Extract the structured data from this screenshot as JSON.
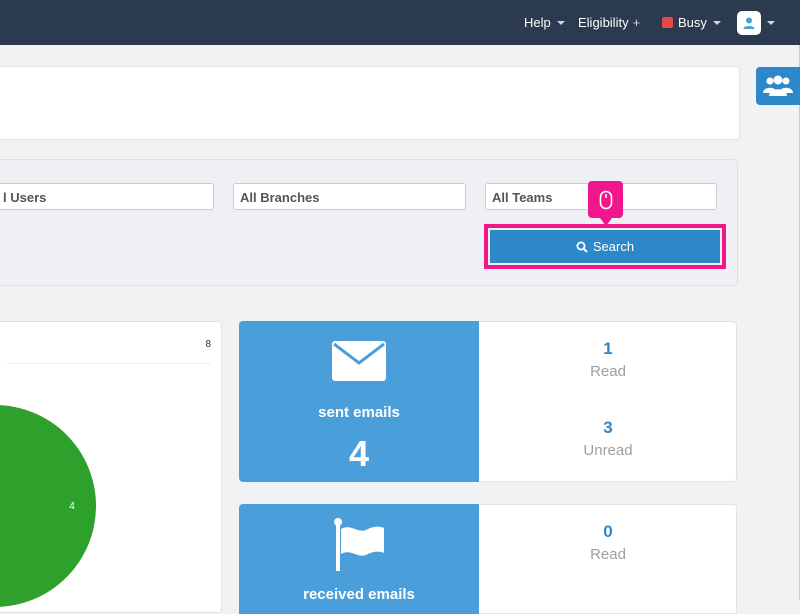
{
  "topbar": {
    "help_label": "Help",
    "eligibility_label": "Eligibility",
    "eligibility_suffix": "+",
    "status_label": "Busy",
    "status_color": "#e5484d",
    "bg_color": "#2b3a4f"
  },
  "filters": {
    "users_value": "l Users",
    "branches_value": "All Branches",
    "teams_value": "All Teams",
    "search_label": "Search"
  },
  "chart_card": {
    "corner_value": "8",
    "slice_value": "4",
    "slice_color": "#2ea02c"
  },
  "chart_data": {
    "type": "pie",
    "values": [
      4
    ],
    "labels": [
      "4"
    ],
    "colors": [
      "#2ea02c"
    ]
  },
  "sent_emails": {
    "title": "sent emails",
    "total": "4",
    "read_count": "1",
    "read_label": "Read",
    "unread_count": "3",
    "unread_label": "Unread"
  },
  "received_emails": {
    "title": "received emails",
    "read_count": "0",
    "read_label": "Read"
  },
  "accent_color": "#2d88c9",
  "highlight_color": "#f0178c"
}
